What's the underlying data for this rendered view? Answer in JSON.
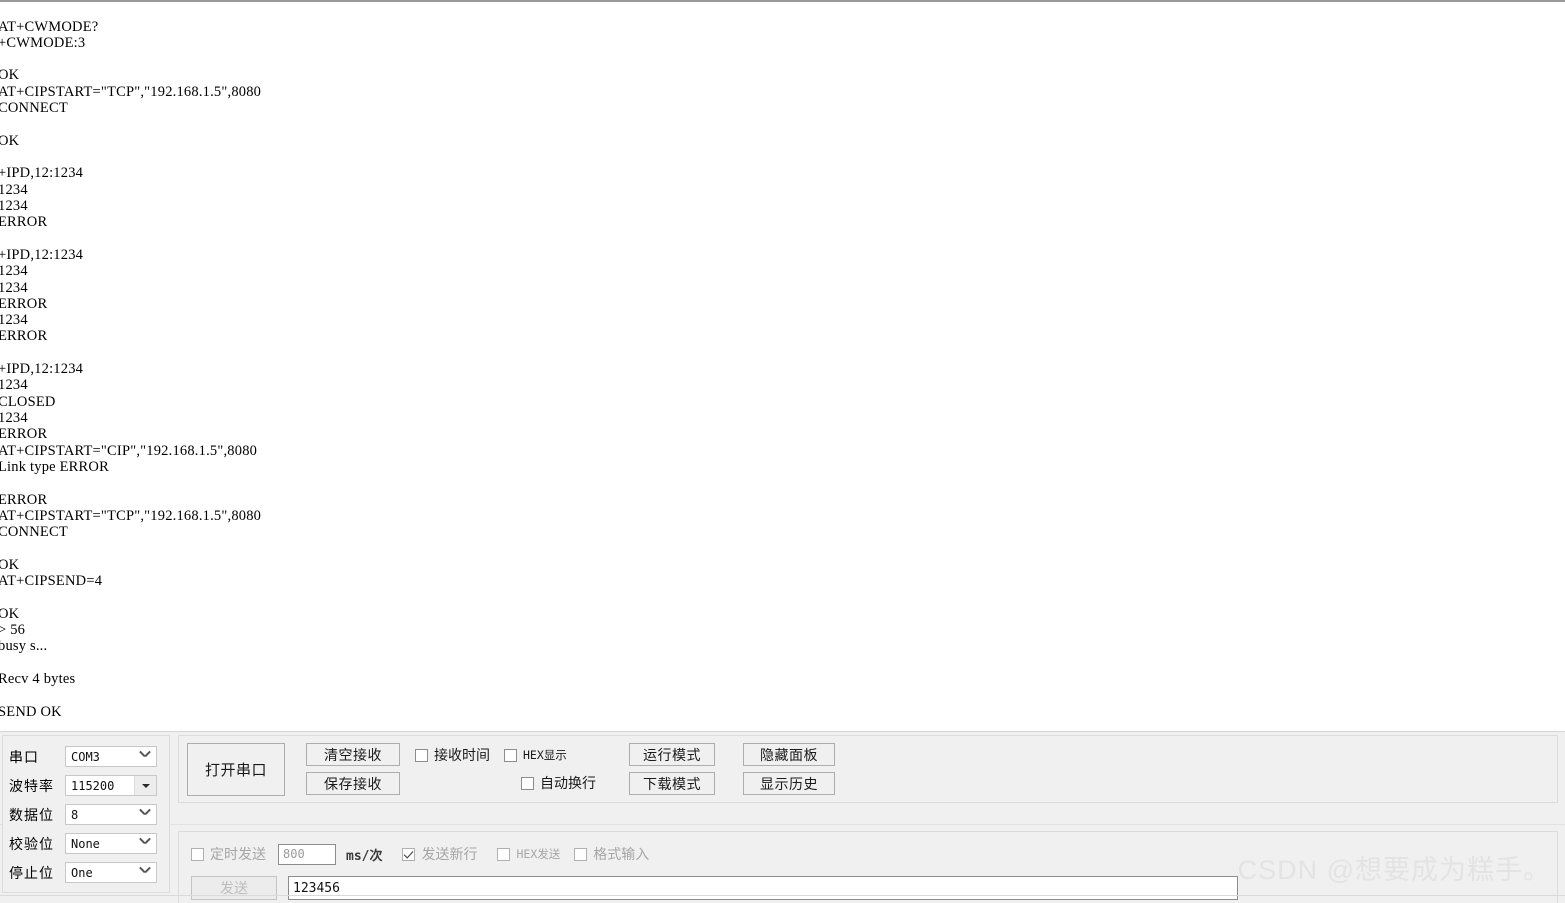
{
  "terminal": {
    "name": "receive-log",
    "content": "AT+CWMODE?\n+CWMODE:3\n\nOK\nAT+CIPSTART=\"TCP\",\"192.168.1.5\",8080\nCONNECT\n\nOK\n\n+IPD,12:1234\n1234\n1234\nERROR\n\n+IPD,12:1234\n1234\n1234\nERROR\n1234\nERROR\n\n+IPD,12:1234\n1234\nCLOSED\n1234\nERROR\nAT+CIPSTART=\"CIP\",\"192.168.1.5\",8080\nLink type ERROR\n\nERROR\nAT+CIPSTART=\"TCP\",\"192.168.1.5\",8080\nCONNECT\n\nOK\nAT+CIPSEND=4\n\nOK\n> 56\nbusy s...\n\nRecv 4 bytes\n\nSEND OK"
  },
  "serial_settings": {
    "rows": [
      {
        "label": "串口",
        "value": "COM3",
        "arrow": "chevron-down-icon"
      },
      {
        "label": "波特率",
        "value": "115200",
        "arrow": "triangle-down-icon"
      },
      {
        "label": "数据位",
        "value": "8",
        "arrow": "chevron-down-icon"
      },
      {
        "label": "校验位",
        "value": "None",
        "arrow": "chevron-down-icon"
      },
      {
        "label": "停止位",
        "value": "One",
        "arrow": "chevron-down-icon"
      }
    ]
  },
  "actions": {
    "open_port": "打开串口",
    "clear_receive": "清空接收",
    "save_receive": "保存接收",
    "run_mode": "运行模式",
    "download_mode": "下载模式",
    "hide_panel": "隐藏面板",
    "show_history": "显示历史"
  },
  "receive_options": [
    {
      "label": "接收时间",
      "checked": false,
      "mono": false,
      "disabled": false
    },
    {
      "label": "HEX显示",
      "checked": false,
      "mono": true,
      "disabled": false
    },
    {
      "label": "自动换行",
      "checked": false,
      "mono": false,
      "disabled": false
    }
  ],
  "send_options": {
    "timed_send": {
      "label": "定时发送",
      "checked": false,
      "disabled": true
    },
    "interval_value": "800",
    "interval_unit": "ms/次",
    "newline": {
      "label": "发送新行",
      "checked": true,
      "disabled": true
    },
    "hex_send": {
      "label": "HEX发送",
      "checked": false,
      "disabled": true
    },
    "format_input": {
      "label": "格式输入",
      "checked": false,
      "disabled": true
    },
    "send_button": "发送",
    "send_text": "123456"
  },
  "watermark": "CSDN @想要成为糕手。",
  "colors": {
    "panel_bg": "#f0f0f0",
    "terminal_bg": "#ffffff",
    "text": "#000000",
    "border": "#adadad",
    "watermark": "#e3e3e3"
  }
}
